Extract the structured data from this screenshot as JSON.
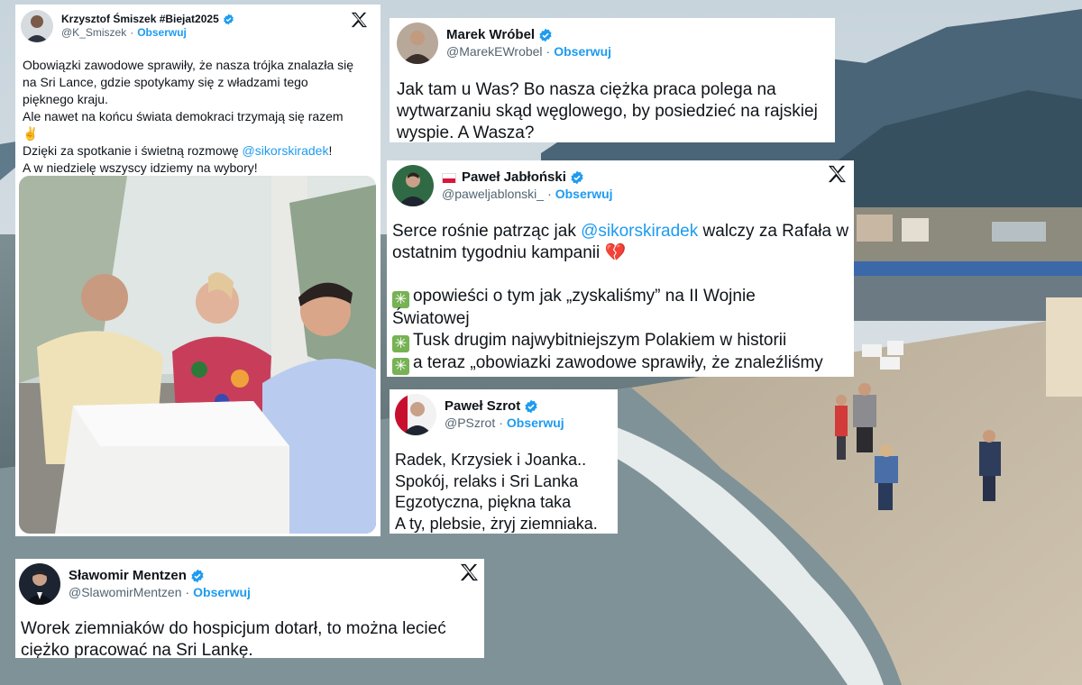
{
  "colors": {
    "link_blue": "#1d9bf0",
    "verified_blue": "#1d9bf0",
    "text_dark": "#0f1419",
    "text_gray": "#536471",
    "card_bg": "#ffffff"
  },
  "icons": {
    "verified": "verified-badge-icon",
    "x_logo": "x-logo-icon",
    "flag": "poland-flag-icon",
    "sparkle": "sparkle-icon",
    "broken_heart": "broken-heart-icon"
  },
  "tweets": [
    {
      "name": "Krzysztof Śmiszek #Biejat2025",
      "handle": "@K_Smiszek",
      "separator": "·",
      "follow": "Obserwuj",
      "lines": {
        "l1": "Obowiązki zawodowe sprawiły, że nasza trójka znalazła się",
        "l2": "na Sri Lance, gdzie spotykamy się z władzami tego",
        "l3": "pięknego kraju.",
        "l4": "Ale nawet na końcu świata demokraci trzymają się razem",
        "l5": "✌️",
        "l6_before": "Dzięki za spotkanie i świetną rozmowę ",
        "l6_mention": "@sikorskiradek",
        "l6_after": "!",
        "l7": "A w niedzielę wszyscy idziemy na wybory!"
      }
    },
    {
      "name": "Marek Wróbel",
      "handle": "@MarekEWrobel",
      "separator": "·",
      "follow": "Obserwuj",
      "lines": {
        "l1": "Jak tam u Was? Bo nasza ciężka praca polega na",
        "l2": "wytwarzaniu skąd węglowego, by posiedzieć na rajskiej",
        "l3": "wyspie. A Wasza?"
      }
    },
    {
      "name": "Paweł Jabłoński",
      "handle": "@paweljablonski_",
      "separator": "·",
      "follow": "Obserwuj",
      "lines": {
        "l1_before": "Serce rośnie patrząc jak ",
        "l1_mention": "@sikorskiradek",
        "l1_after": " walczy za Rafała w",
        "l2": "ostatnim tygodniu kampanii",
        "l2_emoji": "💔",
        "l3": "opowieści o tym jak „zyskaliśmy” na II Wojnie",
        "l4": "Światowej",
        "l5": "Tusk drugim najwybitniejszym Polakiem w historii",
        "l6": "a teraz „obowiazki zawodowe sprawiły, że znaleźliśmy"
      }
    },
    {
      "name": "Paweł Szrot",
      "handle": "@PSzrot",
      "separator": "·",
      "follow": "Obserwuj",
      "lines": {
        "l1": "Radek, Krzysiek i Joanka..",
        "l2": "Spokój, relaks i Sri Lanka",
        "l3": "Egzotyczna, piękna taka",
        "l4": "A ty, plebsie, żryj ziemniaka."
      }
    },
    {
      "name": "Sławomir Mentzen",
      "handle": "@SlawomirMentzen",
      "separator": "·",
      "follow": "Obserwuj",
      "lines": {
        "l1": "Worek ziemniaków do hospicjum dotarł, to można lecieć",
        "l2": "ciężko pracować na Sri Lankę."
      }
    }
  ]
}
